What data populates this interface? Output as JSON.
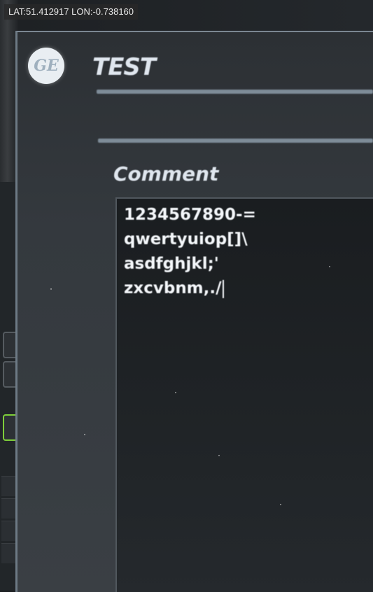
{
  "overlay": {
    "gps": "LAT:51.412917 LON:-0.738160"
  },
  "header": {
    "logo_text": "GE",
    "title": "TEST"
  },
  "comment": {
    "label": "Comment",
    "lines": [
      "1234567890-=",
      "qwertyuiop[]\\",
      "asdfghjkl;'",
      "zxcvbnm,./"
    ]
  },
  "colors": {
    "screen_bg": "#2c3034",
    "text": "#f4f7fa",
    "divider": "#7e8c98",
    "highlight_button": "#7fcf3a"
  },
  "icons": [
    "ge-logo-icon"
  ]
}
